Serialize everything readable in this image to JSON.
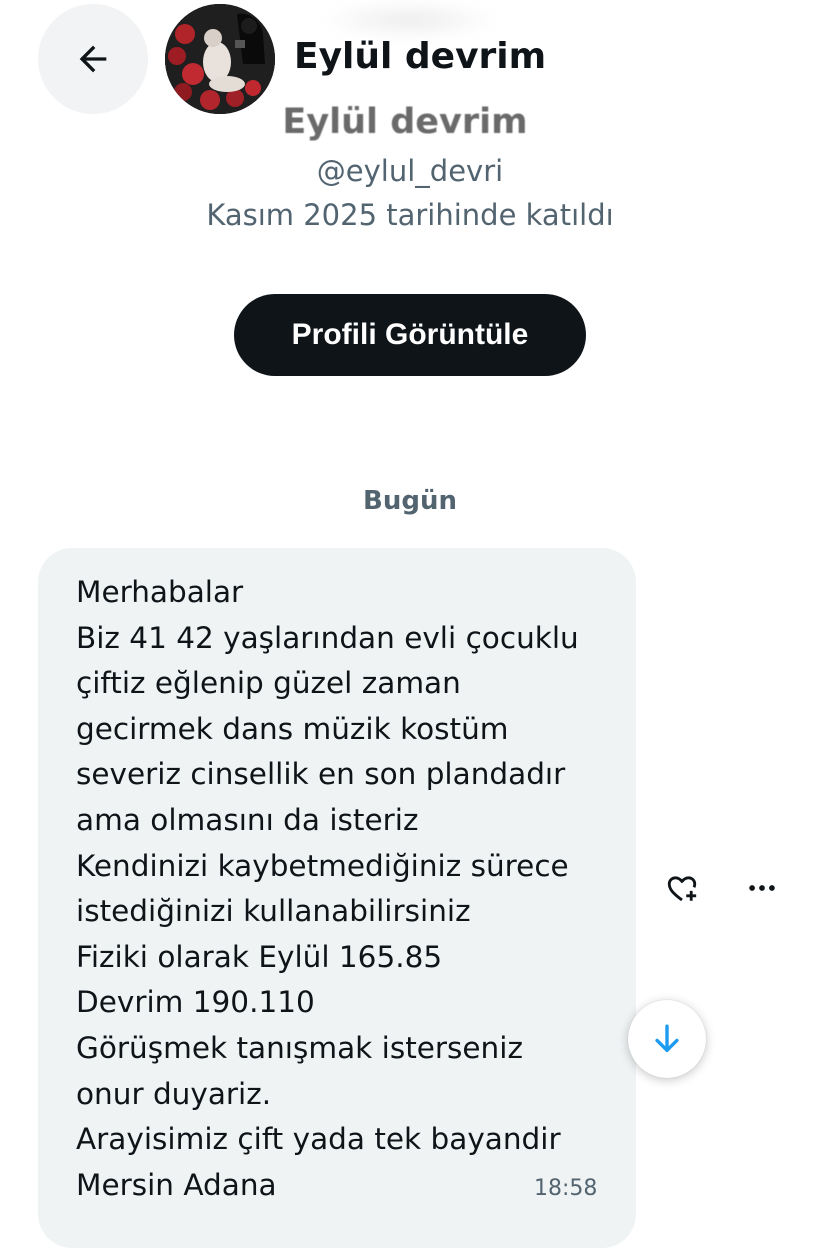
{
  "header": {
    "name": "Eylül devrim",
    "back_icon": "arrow-left-icon"
  },
  "profile": {
    "name": "Eylül devrim",
    "handle": "@eylul_devri",
    "joined": "Kasım 2025 tarihinde katıldı",
    "view_button_label": "Profili Görüntüle"
  },
  "conversation": {
    "date_label": "Bugün",
    "message": {
      "lines": [
        "Merhabalar",
        "Biz 41 42 yaşlarından evli çocuklu",
        "çiftiz eğlenip güzel zaman",
        "gecirmek dans müzik kostüm",
        "severiz cinsellik en son plandadır",
        "ama olmasını da isteriz",
        "Kendinizi kaybetmediğiniz sürece",
        "istediğinizi kullanabilirsiniz",
        "Fiziki olarak Eylül 165.85",
        "Devrim 190.110",
        "Görüşmek tanışmak isterseniz",
        "onur duyariz.",
        "Arayisimiz çift yada tek bayandir",
        "Mersin Adana"
      ],
      "time": "18:58"
    },
    "actions": {
      "react_icon": "heart-plus-icon",
      "more_icon": "more-horizontal-icon",
      "scroll_icon": "arrow-down-icon"
    }
  },
  "colors": {
    "primary_text": "#0f1419",
    "secondary_text": "#536471",
    "bubble_background": "#eff3f4",
    "button_background": "#0f1419",
    "accent_blue": "#1d9bf0"
  }
}
